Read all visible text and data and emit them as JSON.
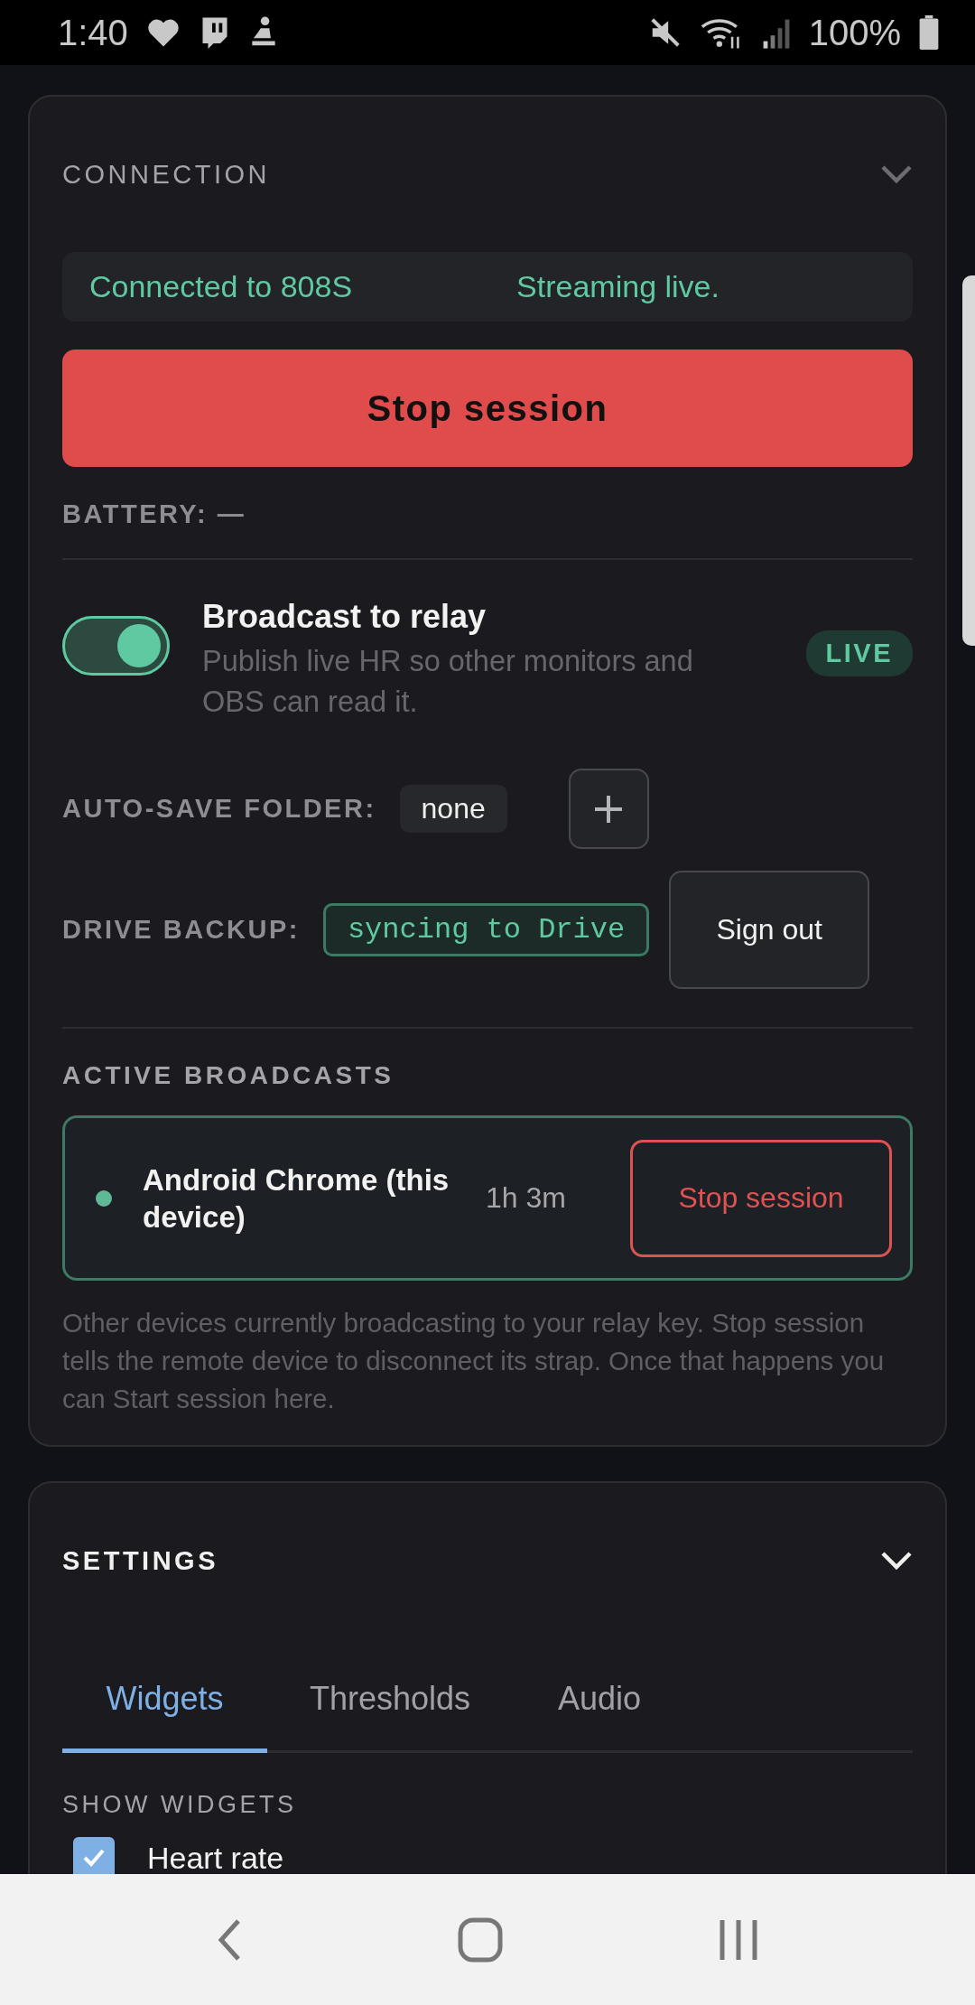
{
  "status_bar": {
    "time": "1:40",
    "battery": "100%"
  },
  "connection": {
    "title": "CONNECTION",
    "connected_text": "Connected to 808S",
    "state_text": "Streaming live.",
    "stop_button": "Stop session",
    "battery_label": "BATTERY: —"
  },
  "broadcast": {
    "title": "Broadcast to relay",
    "description": "Publish live HR so other monitors and OBS can read it.",
    "on": true,
    "badge": "LIVE"
  },
  "auto_save": {
    "label": "AUTO-SAVE FOLDER:",
    "value": "none"
  },
  "drive_backup": {
    "label": "DRIVE BACKUP:",
    "status": "syncing to Drive",
    "button": "Sign out"
  },
  "active_broadcasts": {
    "title": "ACTIVE BROADCASTS",
    "items": [
      {
        "name": "Android Chrome (this device)",
        "duration": "1h 3m",
        "button": "Stop session",
        "color": "#5fb896"
      }
    ],
    "note": "Other devices currently broadcasting to your relay key. Stop session tells the remote device to disconnect its strap. Once that happens you can Start session here."
  },
  "settings": {
    "title": "SETTINGS",
    "tabs": [
      {
        "label": "Widgets",
        "selected": true
      },
      {
        "label": "Thresholds",
        "selected": false
      },
      {
        "label": "Audio",
        "selected": false
      }
    ],
    "section_title": "SHOW WIDGETS",
    "widgets": [
      {
        "label": "Heart rate",
        "checked": true
      }
    ]
  }
}
